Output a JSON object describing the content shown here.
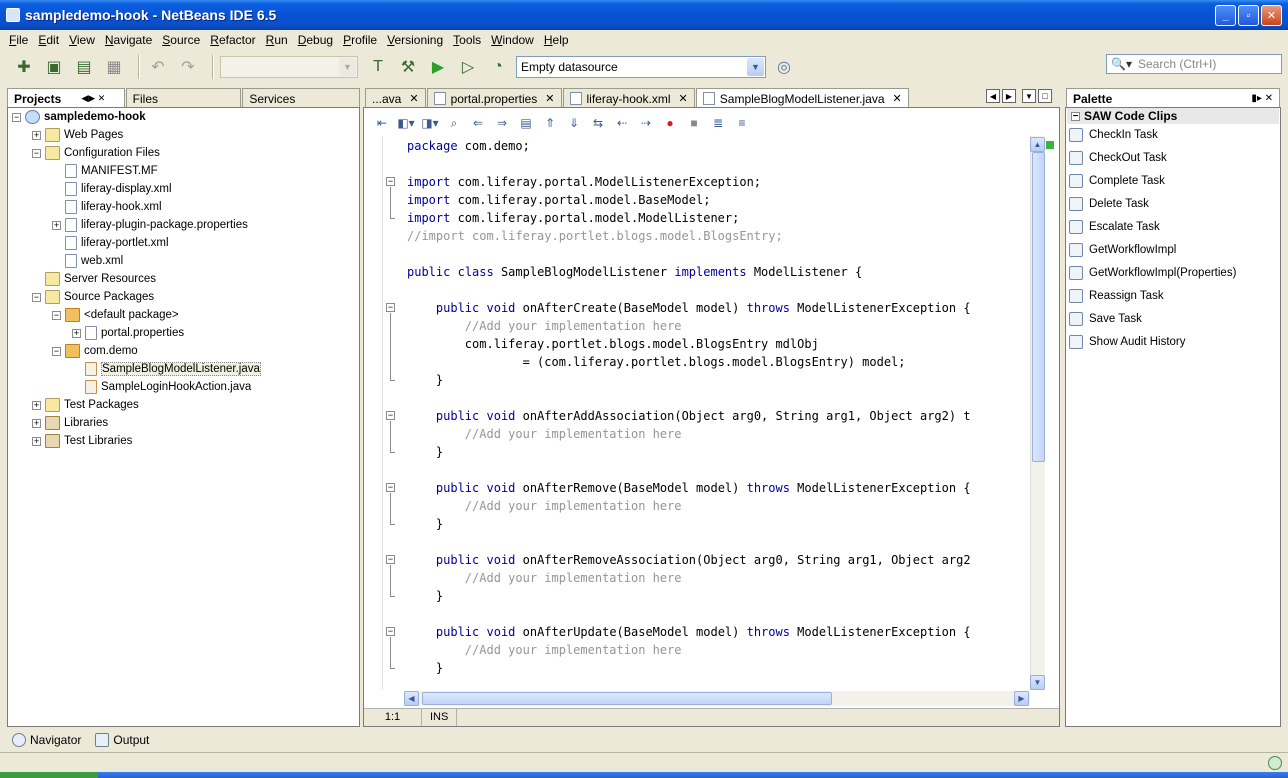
{
  "window": {
    "title": "sampledemo-hook - NetBeans IDE 6.5"
  },
  "menu": [
    "File",
    "Edit",
    "View",
    "Navigate",
    "Source",
    "Refactor",
    "Run",
    "Debug",
    "Profile",
    "Versioning",
    "Tools",
    "Window",
    "Help"
  ],
  "toolbar": {
    "datasource": "Empty datasource",
    "search_placeholder": "Search (Ctrl+I)"
  },
  "left_tabs": [
    "Projects",
    "Files",
    "Services"
  ],
  "tree": [
    {
      "label": "sampledemo-hook",
      "depth": 0,
      "toggle": "-",
      "icon": "project",
      "bold": true
    },
    {
      "label": "Web Pages",
      "depth": 1,
      "toggle": "+",
      "icon": "folder"
    },
    {
      "label": "Configuration Files",
      "depth": 1,
      "toggle": "-",
      "icon": "folder"
    },
    {
      "label": "MANIFEST.MF",
      "depth": 2,
      "toggle": "",
      "icon": "file"
    },
    {
      "label": "liferay-display.xml",
      "depth": 2,
      "toggle": "",
      "icon": "file"
    },
    {
      "label": "liferay-hook.xml",
      "depth": 2,
      "toggle": "",
      "icon": "file"
    },
    {
      "label": "liferay-plugin-package.properties",
      "depth": 2,
      "toggle": "+",
      "icon": "file"
    },
    {
      "label": "liferay-portlet.xml",
      "depth": 2,
      "toggle": "",
      "icon": "file"
    },
    {
      "label": "web.xml",
      "depth": 2,
      "toggle": "",
      "icon": "file"
    },
    {
      "label": "Server Resources",
      "depth": 1,
      "toggle": "",
      "icon": "folder"
    },
    {
      "label": "Source Packages",
      "depth": 1,
      "toggle": "-",
      "icon": "folder"
    },
    {
      "label": "<default package>",
      "depth": 2,
      "toggle": "-",
      "icon": "pkg"
    },
    {
      "label": "portal.properties",
      "depth": 3,
      "toggle": "+",
      "icon": "file"
    },
    {
      "label": "com.demo",
      "depth": 2,
      "toggle": "-",
      "icon": "pkg"
    },
    {
      "label": "SampleBlogModelListener.java",
      "depth": 3,
      "toggle": "",
      "icon": "java",
      "selected": true
    },
    {
      "label": "SampleLoginHookAction.java",
      "depth": 3,
      "toggle": "",
      "icon": "java"
    },
    {
      "label": "Test Packages",
      "depth": 1,
      "toggle": "+",
      "icon": "folder"
    },
    {
      "label": "Libraries",
      "depth": 1,
      "toggle": "+",
      "icon": "lib"
    },
    {
      "label": "Test Libraries",
      "depth": 1,
      "toggle": "+",
      "icon": "lib"
    }
  ],
  "editor_tabs": [
    {
      "label": "...ava",
      "active": false
    },
    {
      "label": "portal.properties",
      "active": false
    },
    {
      "label": "liferay-hook.xml",
      "active": false
    },
    {
      "label": "SampleBlogModelListener.java",
      "active": true
    }
  ],
  "code": [
    {
      "text": "package com.demo;",
      "fold": ""
    },
    {
      "text": "",
      "fold": ""
    },
    {
      "text": "import com.liferay.portal.ModelListenerException;",
      "fold": "start"
    },
    {
      "text": "import com.liferay.portal.model.BaseModel;",
      "fold": ""
    },
    {
      "text": "import com.liferay.portal.model.ModelListener;",
      "fold": "end"
    },
    {
      "text": "//import com.liferay.portlet.blogs.model.BlogsEntry;",
      "fold": "",
      "comment": true
    },
    {
      "text": "",
      "fold": ""
    },
    {
      "text": "public class SampleBlogModelListener implements ModelListener {",
      "fold": ""
    },
    {
      "text": "",
      "fold": ""
    },
    {
      "text": "    public void onAfterCreate(BaseModel model) throws ModelListenerException {",
      "fold": "start"
    },
    {
      "text": "        //Add your implementation here",
      "fold": "",
      "comment": true
    },
    {
      "text": "        com.liferay.portlet.blogs.model.BlogsEntry mdlObj",
      "fold": ""
    },
    {
      "text": "                = (com.liferay.portlet.blogs.model.BlogsEntry) model;",
      "fold": ""
    },
    {
      "text": "    }",
      "fold": "end"
    },
    {
      "text": "",
      "fold": ""
    },
    {
      "text": "    public void onAfterAddAssociation(Object arg0, String arg1, Object arg2) t",
      "fold": "start"
    },
    {
      "text": "        //Add your implementation here",
      "fold": "",
      "comment": true
    },
    {
      "text": "    }",
      "fold": "end"
    },
    {
      "text": "",
      "fold": ""
    },
    {
      "text": "    public void onAfterRemove(BaseModel model) throws ModelListenerException {",
      "fold": "start"
    },
    {
      "text": "        //Add your implementation here",
      "fold": "",
      "comment": true
    },
    {
      "text": "    }",
      "fold": "end"
    },
    {
      "text": "",
      "fold": ""
    },
    {
      "text": "    public void onAfterRemoveAssociation(Object arg0, String arg1, Object arg2",
      "fold": "start"
    },
    {
      "text": "        //Add your implementation here",
      "fold": "",
      "comment": true
    },
    {
      "text": "    }",
      "fold": "end"
    },
    {
      "text": "",
      "fold": ""
    },
    {
      "text": "    public void onAfterUpdate(BaseModel model) throws ModelListenerException {",
      "fold": "start"
    },
    {
      "text": "        //Add your implementation here",
      "fold": "",
      "comment": true
    },
    {
      "text": "    }",
      "fold": "end"
    }
  ],
  "status": {
    "position": "1:1",
    "mode": "INS"
  },
  "palette": {
    "title": "Palette",
    "category": "SAW Code Clips",
    "items": [
      "CheckIn Task",
      "CheckOut Task",
      "Complete Task",
      "Delete Task",
      "Escalate Task",
      "GetWorkflowImpl",
      "GetWorkflowImpl(Properties)",
      "Reassign Task",
      "Save Task",
      "Show Audit History"
    ]
  },
  "bottom_tabs": [
    "Navigator",
    "Output"
  ]
}
